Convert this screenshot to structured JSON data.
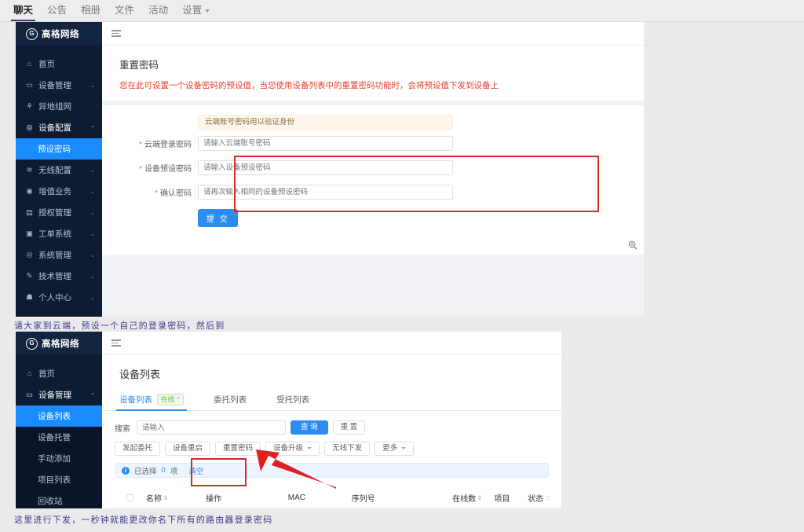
{
  "chat_nav": {
    "items": [
      {
        "label": "聊天",
        "active": true
      },
      {
        "label": "公告",
        "active": false
      },
      {
        "label": "相册",
        "active": false
      },
      {
        "label": "文件",
        "active": false
      },
      {
        "label": "活动",
        "active": false
      },
      {
        "label": "设置",
        "active": false,
        "has_caret": true
      }
    ]
  },
  "brand": {
    "name": "高格网络",
    "mark": "G"
  },
  "panel1": {
    "sidebar": [
      {
        "label": "首页",
        "icon": "home-icon",
        "arrow": ""
      },
      {
        "label": "设备管理",
        "icon": "monitor-icon",
        "arrow": "⌄"
      },
      {
        "label": "异地组网",
        "icon": "network-icon",
        "arrow": ""
      },
      {
        "label": "设备配置",
        "icon": "gear-icon",
        "arrow": "⌃",
        "open": true
      },
      {
        "label": "无线配置",
        "icon": "wifi-icon",
        "arrow": "⌄"
      },
      {
        "label": "增值业务",
        "icon": "value-icon",
        "arrow": "⌄"
      },
      {
        "label": "授权管理",
        "icon": "key-icon",
        "arrow": "⌄"
      },
      {
        "label": "工单系统",
        "icon": "ticket-icon",
        "arrow": "⌄"
      },
      {
        "label": "系统管理",
        "icon": "settings-icon",
        "arrow": "⌄"
      },
      {
        "label": "技术管理",
        "icon": "tool-icon",
        "arrow": "⌄"
      },
      {
        "label": "个人中心",
        "icon": "user-icon",
        "arrow": "⌄"
      }
    ],
    "submenu_active": "预设密码",
    "title": "重置密码",
    "description": "您在此可设置一个设备密码的预设值，当您使用设备列表中的重置密码功能时，会将预设值下发到设备上",
    "notice": "云端账号密码用以验证身份",
    "fields": [
      {
        "label": "云端登录密码",
        "placeholder": "请输入云端账号密码",
        "required": true
      },
      {
        "label": "设备预设密码",
        "placeholder": "请输入设备预设密码",
        "required": true
      },
      {
        "label": "确认密码",
        "placeholder": "请再次输入相同的设备预设密码",
        "required": true
      }
    ],
    "submit_label": "提 交",
    "zoom_icon": "zoom-in-icon"
  },
  "caption1": "请大家到云端，预设一个自己的登录密码，然后到",
  "caption2": "这里进行下发，一秒钟就能更改你名下所有的路由器登录密码",
  "panel2": {
    "sidebar": [
      {
        "label": "首页",
        "icon": "home-icon",
        "arrow": ""
      },
      {
        "label": "设备管理",
        "icon": "monitor-icon",
        "arrow": "⌃",
        "open": true
      }
    ],
    "submenu": [
      {
        "label": "设备列表",
        "active": true
      },
      {
        "label": "设备托管",
        "active": false
      },
      {
        "label": "手动添加",
        "active": false
      },
      {
        "label": "项目列表",
        "active": false
      },
      {
        "label": "回收站",
        "active": false
      }
    ],
    "title": "设备列表",
    "tabs": [
      {
        "label": "设备列表",
        "active": true,
        "badge": "在线",
        "badge_close": "×"
      },
      {
        "label": "委托列表",
        "active": false
      },
      {
        "label": "受托列表",
        "active": false
      }
    ],
    "search_label": "搜索",
    "search_placeholder": "请输入",
    "search_button": "查 询",
    "reset_button": "重 置",
    "action_buttons": [
      {
        "label": "发起委托",
        "caret": false
      },
      {
        "label": "设备重启",
        "caret": false
      },
      {
        "label": "重置密码",
        "caret": false,
        "highlighted": true
      },
      {
        "label": "设备升级",
        "caret": true
      },
      {
        "label": "无线下发",
        "caret": false
      },
      {
        "label": "更多",
        "caret": true
      }
    ],
    "info_prefix": "已选择",
    "info_count": "0",
    "info_suffix": "项",
    "info_clear": "清空",
    "table_headers": [
      {
        "label": "名称",
        "sortable": true
      },
      {
        "label": "操作",
        "sortable": false
      },
      {
        "label": "MAC",
        "sortable": false
      },
      {
        "label": "序列号",
        "sortable": false
      },
      {
        "label": "在线数",
        "sortable": true
      },
      {
        "label": "项目",
        "sortable": false
      },
      {
        "label": "状态",
        "filter": true
      }
    ]
  },
  "colors": {
    "brand_dark": "#0d1b33",
    "accent_blue": "#2d8cf0",
    "highlight_red": "#d62b26",
    "desc_red": "#e8412c",
    "caption_blue": "#3a3a8c"
  }
}
